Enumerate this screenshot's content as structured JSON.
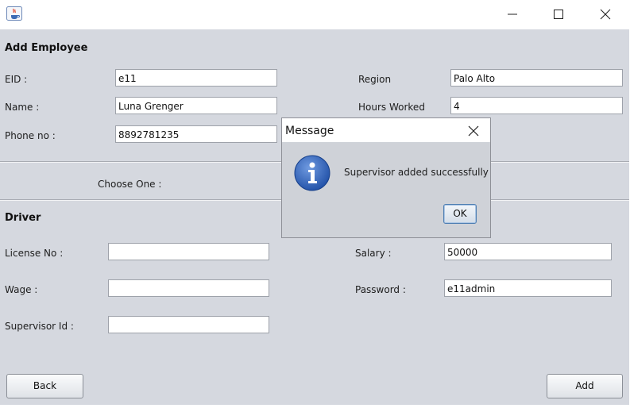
{
  "window": {
    "controls": {
      "minimize": "minimize",
      "maximize": "maximize",
      "close": "close"
    }
  },
  "form": {
    "section_title": "Add Employee",
    "eid_label": "EID :",
    "eid_value": "e11",
    "name_label": "Name :",
    "name_value": "Luna Grenger",
    "phone_label": "Phone no :",
    "phone_value": "8892781235",
    "region_label": "Region",
    "region_value": "Palo Alto",
    "hours_label": "Hours Worked",
    "hours_value": "4",
    "choose_label": "Choose One :",
    "driver_title": "Driver",
    "license_label": "License No :",
    "license_value": "",
    "wage_label": "Wage :",
    "wage_value": "",
    "supervisor_id_label": "Supervisor Id :",
    "supervisor_id_value": "",
    "salary_label": "Salary :",
    "salary_value": "50000",
    "password_label": "Password :",
    "password_value": "e11admin"
  },
  "buttons": {
    "back": "Back",
    "add": "Add"
  },
  "dialog": {
    "title": "Message",
    "message": "Supervisor added successfully",
    "ok": "OK",
    "icon": "info-icon"
  },
  "colors": {
    "panel": "#d5d8df",
    "accent_icon": "#2a5db0"
  }
}
